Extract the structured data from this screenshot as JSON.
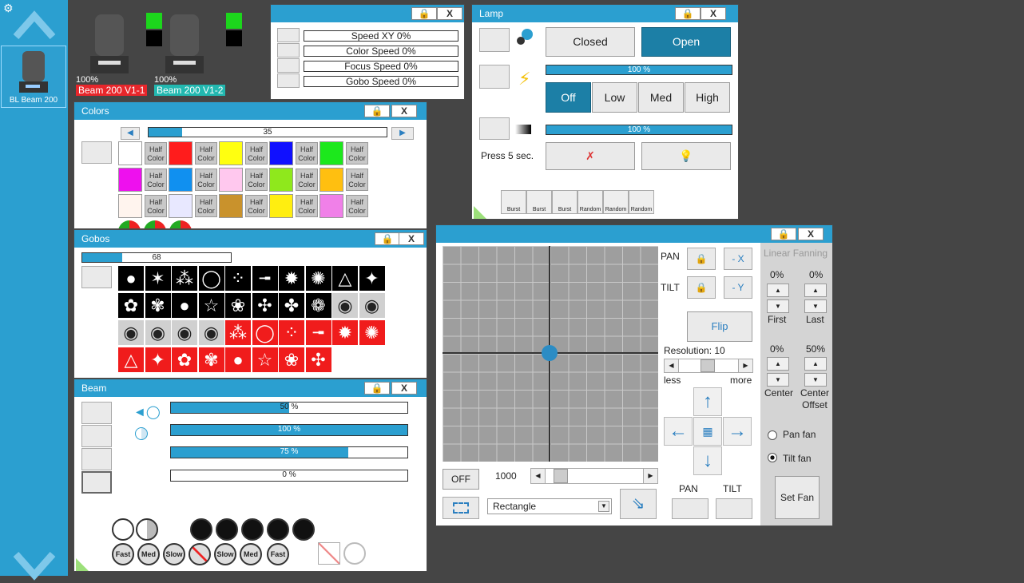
{
  "sidebar": {
    "fixture_label": "BL Beam 200"
  },
  "fixtures": [
    {
      "percent": "100%",
      "name": "Beam 200 V1-1",
      "color": "#e8262b"
    },
    {
      "percent": "100%",
      "name": "Beam 200 V1-2",
      "color": "#22b8b0"
    }
  ],
  "speed_panel": {
    "lock": "🔒",
    "close": "X",
    "rows": [
      "Speed XY     0%",
      "Color Speed     0%",
      "Focus Speed     0%",
      "Gobo Speed     0%"
    ]
  },
  "lamp": {
    "title": "Lamp",
    "lock": "🔒",
    "close": "X",
    "closed_label": "Closed",
    "open_label": "Open",
    "intensity_percent": "100 %",
    "intensity_value": 1.0,
    "power_levels": [
      "Off",
      "Low",
      "Med",
      "High"
    ],
    "power_selected": "Off",
    "dim_percent": "100 %",
    "dim_value": 1.0,
    "press_label": "Press 5 sec.",
    "effect_labels": [
      "Burst",
      "Burst",
      "Burst",
      "Random",
      "Random",
      "Random"
    ]
  },
  "colors": {
    "title": "Colors",
    "lock": "🔒",
    "close": "X",
    "scroll_value": "35",
    "scroll_fraction": 0.14,
    "half_label": "Half Color",
    "row1": [
      "#ffffff",
      "#ff1c1c",
      "#ffff10",
      "#1010ff",
      "#1ce81c"
    ],
    "row2": [
      "#ee10ee",
      "#1090f0",
      "#ffc8ee",
      "#8fe81c",
      "#ffbf10"
    ],
    "row3": [
      "#fff4ee",
      "#e8e8ff",
      "#c9922c",
      "#ffee10",
      "#f080e8"
    ]
  },
  "gobos": {
    "title": "Gobos",
    "lock": "🔒",
    "close": "X",
    "value": "68",
    "fraction": 0.27
  },
  "beam": {
    "title": "Beam",
    "lock": "🔒",
    "close": "X",
    "bars": [
      {
        "label": "50 %",
        "value": 0.5
      },
      {
        "label": "100 %",
        "value": 1.0
      },
      {
        "label": "75 %",
        "value": 0.75
      },
      {
        "label": "0 %",
        "value": 0.0
      }
    ],
    "speed_labels": [
      "Fast",
      "Med",
      "Slow",
      "",
      "Slow",
      "Med",
      "Fast"
    ]
  },
  "position": {
    "lock": "🔒",
    "close": "X",
    "pan_label": "PAN",
    "tilt_label": "TILT",
    "minus_x": "- X",
    "minus_y": "- Y",
    "flip_label": "Flip",
    "resolution_label": "Resolution: 10",
    "less_label": "less",
    "more_label": "more",
    "off_label": "OFF",
    "speed_value": "1000",
    "shape_value": "Rectangle",
    "pan_bottom_label": "PAN",
    "tilt_bottom_label": "TILT",
    "fanning_label": "Linear Fanning",
    "first_percent": "0%",
    "last_percent": "0%",
    "first_label": "First",
    "last_label": "Last",
    "center_percent": "0%",
    "center_offset_percent": "50%",
    "center_label": "Center",
    "center_offset_label": "Center Offset",
    "pan_fan_label": "Pan fan",
    "tilt_fan_label": "Tilt fan",
    "set_fan_label": "Set Fan"
  }
}
